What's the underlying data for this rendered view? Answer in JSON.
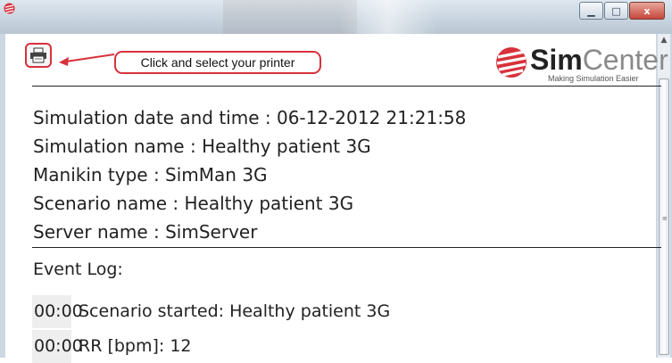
{
  "callout": {
    "text": "Click and select your printer"
  },
  "logo": {
    "name_bold": "Sim",
    "name_light": "Center",
    "tagline": "Making Simulation Easier"
  },
  "info": {
    "date_time": "Simulation date and time : 06-12-2012 21:21:58",
    "simulation_name": "Simulation name : Healthy patient 3G",
    "manikin_type": "Manikin type : SimMan 3G",
    "scenario_name": "Scenario name : Healthy patient 3G",
    "server_name": "Server name : SimServer"
  },
  "event_log": {
    "label": "Event Log:",
    "entries": [
      {
        "time": "00:00",
        "event": "Scenario started: Healthy patient 3G"
      },
      {
        "time": "00:00",
        "event": "RR [bpm]: 12"
      }
    ]
  },
  "colors": {
    "accent_red": "#d8313b"
  },
  "icons": [
    "app-logo-icon",
    "printer-icon",
    "minimize-icon",
    "maximize-icon",
    "close-icon",
    "scroll-up-icon"
  ]
}
